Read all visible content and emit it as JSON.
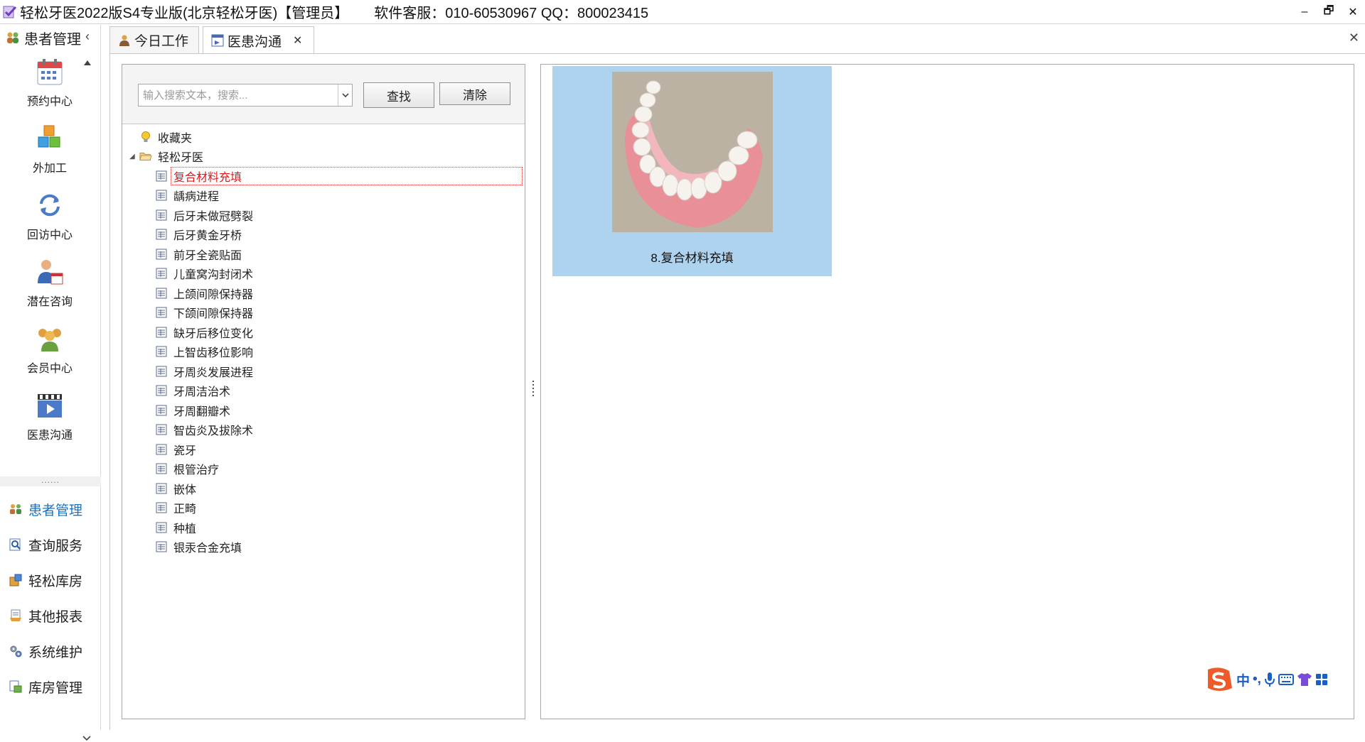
{
  "window": {
    "title": "轻松牙医2022版S4专业版(北京轻松牙医)【管理员】",
    "service": "软件客服：010-60530967 QQ：800023415",
    "minimize": "–",
    "restore": "🗗",
    "close": "✕"
  },
  "sidebar": {
    "header": "患者管理",
    "collapse": "‹",
    "big_items": [
      {
        "label": "预约中心",
        "icon": "calendar-icon"
      },
      {
        "label": "外加工",
        "icon": "cubes-icon"
      },
      {
        "label": "回访中心",
        "icon": "refresh-icon"
      },
      {
        "label": "潜在咨询",
        "icon": "user-calendar-icon"
      },
      {
        "label": "会员中心",
        "icon": "members-icon"
      },
      {
        "label": "医患沟通",
        "icon": "video-clapper-icon"
      }
    ],
    "splitter": "......",
    "nav_items": [
      {
        "label": "患者管理",
        "icon": "patients-icon",
        "active": true
      },
      {
        "label": "查询服务",
        "icon": "query-icon",
        "active": false
      },
      {
        "label": "轻松库房",
        "icon": "warehouse-icon",
        "active": false
      },
      {
        "label": "其他报表",
        "icon": "report-icon",
        "active": false
      },
      {
        "label": "系统维护",
        "icon": "gears-icon",
        "active": false
      },
      {
        "label": "库房管理",
        "icon": "inventory-icon",
        "active": false
      }
    ]
  },
  "tabs": [
    {
      "label": "今日工作",
      "icon": "worker-icon",
      "active": false
    },
    {
      "label": "医患沟通",
      "icon": "communication-icon",
      "active": true,
      "close": "✕"
    }
  ],
  "tabbar_close": "✕",
  "search": {
    "placeholder": "输入搜索文本，搜索...",
    "value": "",
    "find_label": "查找",
    "clear_label": "清除"
  },
  "tree": {
    "favorites": "收藏夹",
    "root": "轻松牙医",
    "root_expander": "◢",
    "items": [
      "复合材料充填",
      "龋病进程",
      "后牙未做冠劈裂",
      "后牙黄金牙桥",
      "前牙全瓷贴面",
      "儿童窝沟封闭术",
      "上颌间隙保持器",
      "下颌间隙保持器",
      "缺牙后移位变化",
      "上智齿移位影响",
      "牙周炎发展进程",
      "牙周洁治术",
      "牙周翻瓣术",
      "智齿炎及拔除术",
      "瓷牙",
      "根管治疗",
      "嵌体",
      "正畸",
      "种植",
      "银汞合金充填"
    ],
    "selected_index": 0
  },
  "gallery": {
    "items": [
      {
        "caption": "8.复合材料充填"
      }
    ]
  },
  "ime": {
    "lang": "中",
    "punct": "•,"
  },
  "colors": {
    "selected_text": "#e8141b",
    "active_nav": "#1a73c8",
    "gallery_bg": "#aed3ef",
    "ime_logo": "#f05a28"
  }
}
